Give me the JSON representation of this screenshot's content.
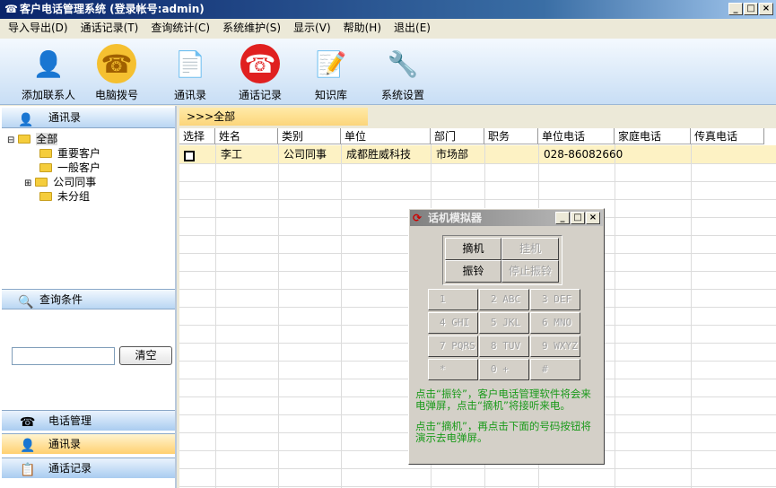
{
  "window": {
    "title": "客户电话管理系统 (登录帐号:admin)",
    "buttons": [
      "_",
      "□",
      "×"
    ]
  },
  "menu": [
    "导入导出(D)",
    "通话记录(T)",
    "查询统计(C)",
    "系统维护(S)",
    "显示(V)",
    "帮助(H)",
    "退出(E)"
  ],
  "toolbar": [
    {
      "label": "添加联系人",
      "icon": "add-contact-icon"
    },
    {
      "label": "电脑拨号",
      "icon": "telephone-icon"
    },
    {
      "label": "通讯录",
      "icon": "address-book-icon"
    },
    {
      "label": "通话记录",
      "icon": "call-log-icon"
    },
    {
      "label": "知识库",
      "icon": "knowledge-base-icon"
    },
    {
      "label": "系统设置",
      "icon": "tools-icon"
    }
  ],
  "left": {
    "contacts_header": "通讯录",
    "tree": {
      "root": "全部",
      "children": [
        "重要客户",
        "一般客户",
        "公司同事",
        "未分组"
      ]
    },
    "query_header": "查询条件",
    "query_value": "",
    "clear_button": "清空",
    "nav": [
      "电话管理",
      "通讯录",
      "通话记录"
    ]
  },
  "breadcrumb": ">>>全部",
  "grid": {
    "columns": [
      "选择",
      "姓名",
      "类别",
      "单位",
      "部门",
      "职务",
      "单位电话",
      "家庭电话",
      "传真电话"
    ],
    "rows": [
      {
        "selected": false,
        "cells": [
          "李工",
          "公司同事",
          "成都胜威科技",
          "市场部",
          "",
          "028-86082660",
          "",
          ""
        ]
      }
    ]
  },
  "dialog": {
    "title": "话机模拟器",
    "pickup": "摘机",
    "hangup": "挂机",
    "ring": "振铃",
    "stop_ring": "停止振铃",
    "keys": [
      "1",
      "2 ABC",
      "3 DEF",
      "4 GHI",
      "5 JKL",
      "6 MNO",
      "7 PQRS",
      "8 TUV",
      "9 WXYZ",
      "*",
      "0   +",
      "#"
    ],
    "hint1": "点击“振铃”，客户电话管理软件将会来电弹屏，点击“摘机”将接听来电。",
    "hint2": "点击“摘机”，再点击下面的号码按钮将演示去电弹屏。"
  }
}
